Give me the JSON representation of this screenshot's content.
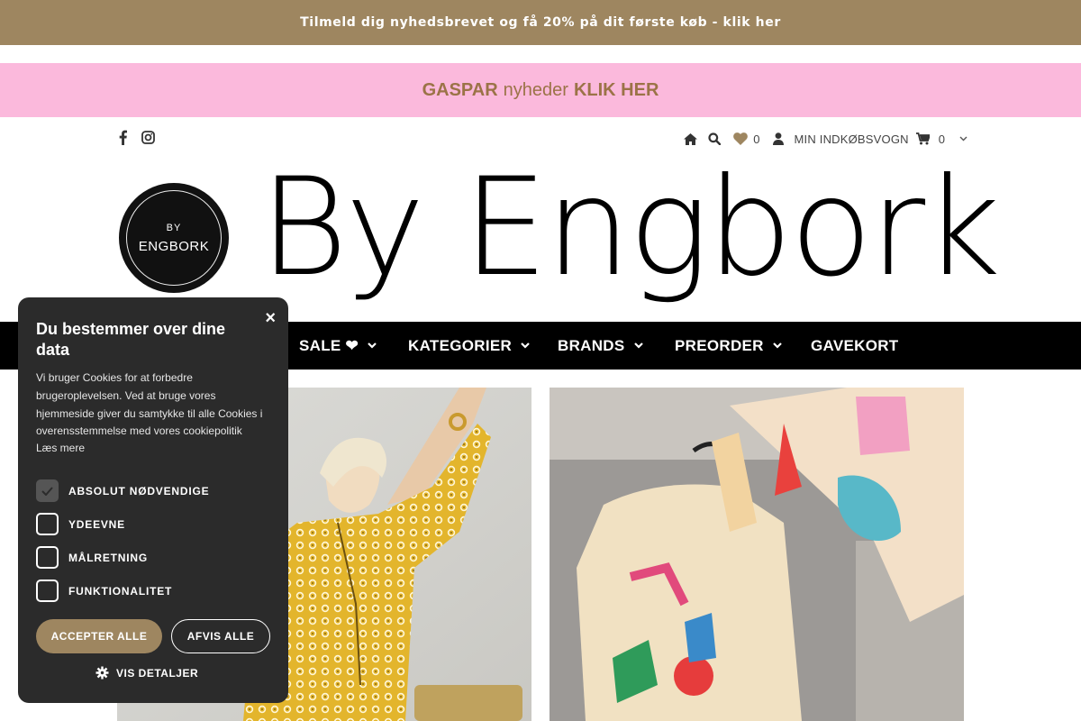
{
  "announcement": "Tilmeld dig nyhedsbrevet og få 20% på dit første køb - klik her",
  "promo": {
    "brand": "GASPAR",
    "middle": "nyheder",
    "cta": "KLIK HER"
  },
  "header": {
    "wishlist_count": "0",
    "cart_label": "MIN INDKØBSVOGN",
    "cart_count": "0"
  },
  "logo": {
    "badge_top": "BY",
    "badge_bottom": "ENGBORK",
    "wordmark": "By Engbork"
  },
  "nav": {
    "sale": "SALE ❤",
    "categories": "KATEGORIER",
    "brands": "BRANDS",
    "preorder": "PREORDER",
    "giftcard": "GAVEKORT"
  },
  "cookie": {
    "close": "×",
    "title": "Du bestemmer over dine data",
    "description": "Vi bruger Cookies for at forbedre brugeroplevelsen. Ved at bruge vores hjemmeside giver du samtykke til alle Cookies i overensstemmelse med vores cookiepolitik",
    "read_more": "Læs mere",
    "options": [
      {
        "label": "ABSOLUT NØDVENDIGE",
        "checked": true
      },
      {
        "label": "YDEEVNE",
        "checked": false
      },
      {
        "label": "MÅLRETNING",
        "checked": false
      },
      {
        "label": "FUNKTIONALITET",
        "checked": false
      }
    ],
    "accept_all": "ACCEPTER ALLE",
    "decline_all": "AFVIS ALLE",
    "show_details": "VIS DETALJER"
  },
  "colors": {
    "gold": "#9e8660",
    "pink": "#fbb9dc",
    "promo_text": "#9b7347",
    "nav_bg": "#000000",
    "cookie_bg": "#2b2b2b"
  },
  "icons": [
    "facebook-icon",
    "instagram-icon",
    "home-icon",
    "search-icon",
    "heart-icon",
    "user-icon",
    "cart-icon",
    "chevron-down-icon",
    "gear-icon",
    "close-icon",
    "checkmark-icon"
  ]
}
